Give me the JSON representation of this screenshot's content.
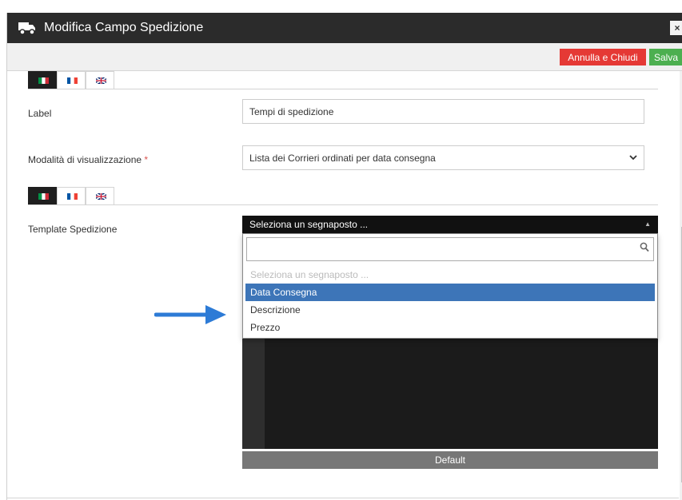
{
  "window": {
    "title": "Modifica Campo Spedizione",
    "icon": "truck-icon",
    "close_glyph": "×"
  },
  "toolbar": {
    "cancel_label": "Annulla e Chiudi",
    "save_label": "Salva",
    "cancel_color": "#e53935",
    "save_color": "#4caf50"
  },
  "form": {
    "label_field": {
      "label": "Label",
      "value": "Tempi di spedizione"
    },
    "display_mode": {
      "label": "Modalità di visualizzazione",
      "required_mark": "*",
      "value": "Lista dei Corrieri ordinati per data consegna"
    },
    "template": {
      "label": "Template Spedizione"
    },
    "languages": [
      "it",
      "fr",
      "en"
    ]
  },
  "dropdown": {
    "selected": "Seleziona un segnaposto ...",
    "search_value": "",
    "options": [
      "Seleziona un segnaposto ...",
      "Data Consegna",
      "Descrizione",
      "Prezzo"
    ],
    "highlighted_index": 1
  },
  "default_button": "Default",
  "colors": {
    "titlebar": "#2b2b2b",
    "highlight": "#3d75b8",
    "editor": "#1b1b1b",
    "annotation_arrow": "#2d7bd6"
  }
}
